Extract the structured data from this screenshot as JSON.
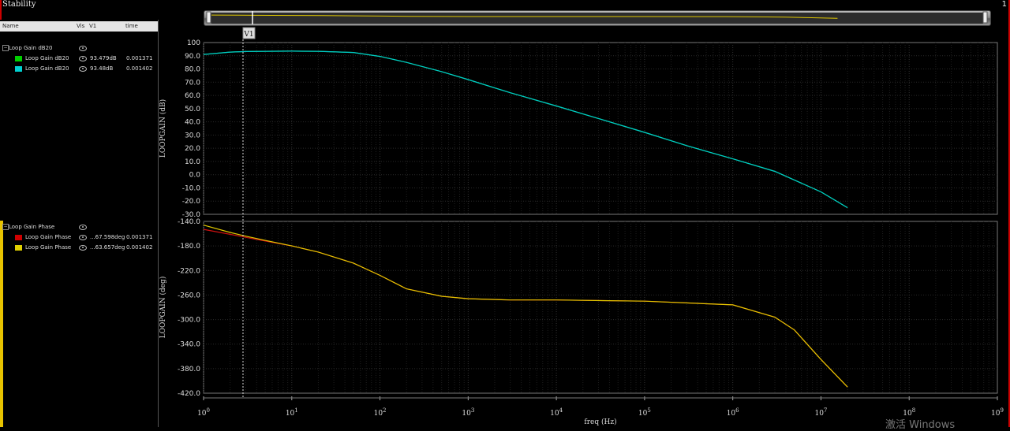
{
  "window": {
    "title": "Stability",
    "number": "1"
  },
  "legend": {
    "columns": [
      "Name",
      "Vis",
      "V1",
      "time"
    ],
    "groups": [
      {
        "name": "Loop Gain dB20",
        "signals": [
          {
            "name": "Loop Gain dB20",
            "color": "#00d000",
            "v1": "93.479dB",
            "time": "0.001371"
          },
          {
            "name": "Loop Gain dB20",
            "color": "#00d0d0",
            "v1": "93.48dB",
            "time": "0.001402"
          }
        ]
      },
      {
        "name": "Loop Gain Phase",
        "signals": [
          {
            "name": "Loop Gain Phase",
            "color": "#d00000",
            "v1": "...67.598deg",
            "time": "0.001371"
          },
          {
            "name": "Loop Gain Phase",
            "color": "#e0d000",
            "v1": "...63.657deg",
            "time": "0.001402"
          }
        ]
      }
    ]
  },
  "marker": {
    "label": "V1",
    "freq": 2.8
  },
  "watermark": "激活 Windows",
  "chart_data": [
    {
      "type": "line",
      "ylabel": "LOOPGAIN (dB)",
      "ylim": [
        -30,
        100
      ],
      "yticks": [
        "100",
        "90.0",
        "80.0",
        "70.0",
        "60.0",
        "50.0",
        "40.0",
        "30.0",
        "20.0",
        "10.0",
        "0.0",
        "-10.0",
        "-20.0",
        "-30.0"
      ],
      "xscale": "log",
      "series": [
        {
          "name": "Loop Gain dB20",
          "color": "#00cc44",
          "x": [
            1,
            2,
            3,
            5,
            10,
            20,
            50,
            100,
            200,
            500,
            1000,
            3000,
            10000,
            30000,
            100000,
            300000,
            1000000,
            3000000,
            10000000,
            20000000
          ],
          "y": [
            91,
            92.8,
            93.2,
            93.4,
            93.5,
            93.4,
            92.5,
            89.5,
            85,
            78,
            72,
            62,
            52,
            42.5,
            32,
            22,
            12,
            2.5,
            -13,
            -25
          ]
        },
        {
          "name": "Loop Gain dB20",
          "color": "#00c8c8",
          "x": [
            1,
            2,
            3,
            5,
            10,
            20,
            50,
            100,
            200,
            500,
            1000,
            3000,
            10000,
            30000,
            100000,
            300000,
            1000000,
            3000000,
            10000000,
            20000000
          ],
          "y": [
            91,
            92.8,
            93.2,
            93.4,
            93.5,
            93.4,
            92.5,
            89.5,
            85,
            78,
            72,
            62,
            52,
            42.5,
            32,
            22,
            12,
            2.5,
            -13,
            -25
          ]
        }
      ]
    },
    {
      "type": "line",
      "xlabel": "freq (Hz)",
      "ylabel": "LOOPGAIN (deg)",
      "ylim": [
        -420,
        -140
      ],
      "yticks": [
        "-140.0",
        "-180.0",
        "-220.0",
        "-260.0",
        "-300.0",
        "-340.0",
        "-380.0",
        "-420.0"
      ],
      "xscale": "log",
      "xlim": [
        1,
        1000000000
      ],
      "xticks": [
        {
          "base": "10",
          "exp": "0"
        },
        {
          "base": "10",
          "exp": "1"
        },
        {
          "base": "10",
          "exp": "2"
        },
        {
          "base": "10",
          "exp": "3"
        },
        {
          "base": "10",
          "exp": "4"
        },
        {
          "base": "10",
          "exp": "5"
        },
        {
          "base": "10",
          "exp": "6"
        },
        {
          "base": "10",
          "exp": "7"
        },
        {
          "base": "10",
          "exp": "8"
        },
        {
          "base": "10",
          "exp": "9"
        }
      ],
      "series": [
        {
          "name": "Loop Gain Phase",
          "color": "#cc1010",
          "x": [
            1,
            2,
            3,
            5,
            10,
            20,
            50,
            100,
            200,
            500,
            1000,
            3000,
            10000,
            100000,
            1000000,
            3000000,
            5000000,
            10000000,
            20000000
          ],
          "y": [
            -153,
            -161,
            -166,
            -172,
            -180,
            -190,
            -208,
            -228,
            -250,
            -262,
            -266,
            -268,
            -268,
            -270,
            -276,
            -296,
            -317,
            -365,
            -410
          ]
        },
        {
          "name": "Loop Gain Phase",
          "color": "#e0c800",
          "x": [
            1,
            2,
            3,
            5,
            10,
            20,
            50,
            100,
            200,
            500,
            1000,
            3000,
            10000,
            100000,
            1000000,
            3000000,
            5000000,
            10000000,
            20000000
          ],
          "y": [
            -146,
            -158,
            -164,
            -171,
            -180,
            -190,
            -208,
            -228,
            -250,
            -262,
            -266,
            -268,
            -268,
            -270,
            -276,
            -296,
            -317,
            -365,
            -410
          ]
        }
      ]
    }
  ]
}
